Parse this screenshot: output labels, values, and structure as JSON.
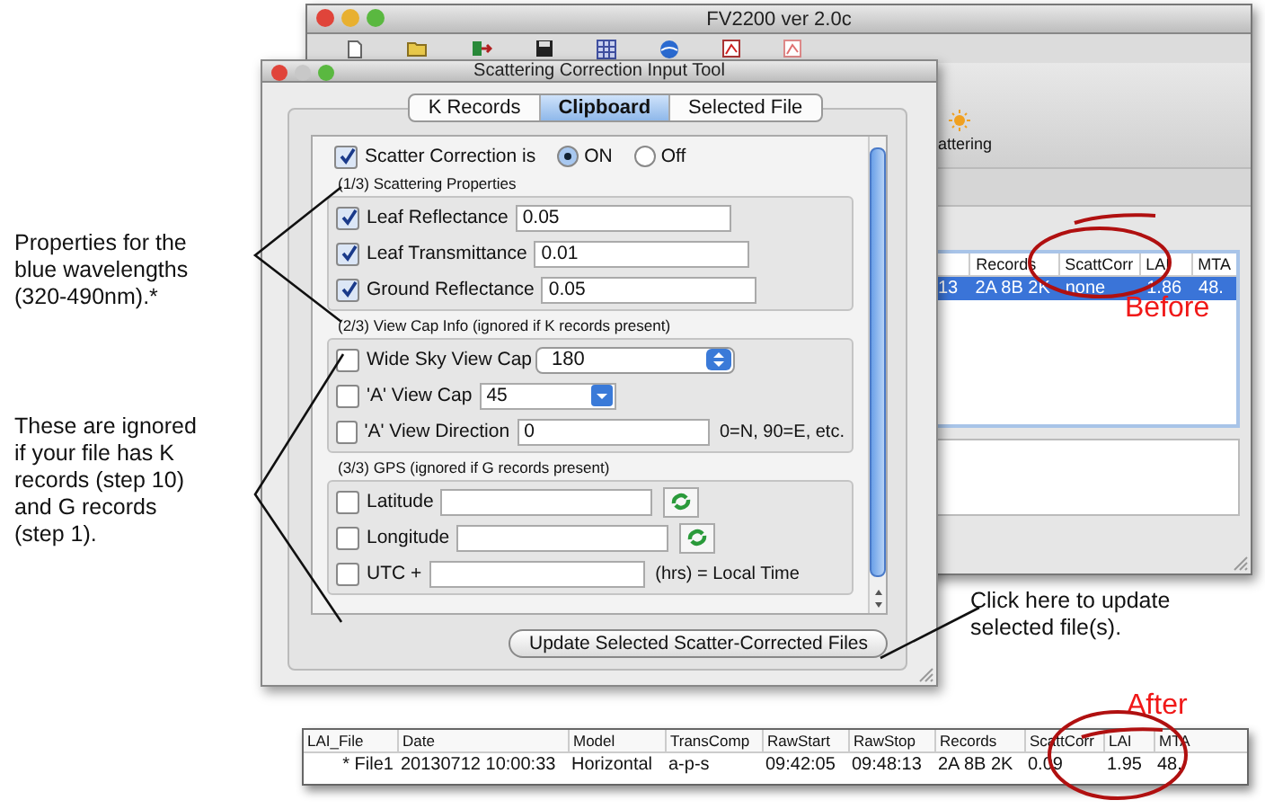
{
  "main_window": {
    "title": "FV2200 ver 2.0c",
    "ribbon_label": "attering",
    "table": {
      "columns": [
        "",
        "Records",
        "ScattCorr",
        "LAI",
        "MTA"
      ],
      "rows": [
        {
          "selected": true,
          "cells": [
            "13",
            "2A 8B 2K",
            "none",
            "1.86",
            "48."
          ]
        }
      ]
    }
  },
  "dialog": {
    "title": "Scattering Correction Input Tool",
    "tabs": [
      {
        "label": "K Records",
        "selected": false
      },
      {
        "label": "Clipboard",
        "selected": true
      },
      {
        "label": "Selected File",
        "selected": false
      }
    ],
    "scatter_correction": {
      "label": "Scatter Correction is",
      "checked": true,
      "options": [
        {
          "label": "ON",
          "selected": true
        },
        {
          "label": "Off",
          "selected": false
        }
      ]
    },
    "sections": [
      {
        "title": "(1/3) Scattering Properties",
        "rows": [
          {
            "kind": "text",
            "label": "Leaf Reflectance",
            "checked": true,
            "value": "0.05"
          },
          {
            "kind": "text",
            "label": "Leaf Transmittance",
            "checked": true,
            "value": "0.01"
          },
          {
            "kind": "text",
            "label": "Ground Reflectance",
            "checked": true,
            "value": "0.05"
          }
        ]
      },
      {
        "title": "(2/3) View Cap Info (ignored if K records present)",
        "rows": [
          {
            "kind": "popup",
            "label": "Wide Sky View Cap",
            "checked": false,
            "value": "180"
          },
          {
            "kind": "combo",
            "label": "'A' View Cap",
            "checked": false,
            "value": "45"
          },
          {
            "kind": "text",
            "label": "'A' View Direction",
            "checked": false,
            "value": "0",
            "note": "0=N, 90=E, etc."
          }
        ]
      },
      {
        "title": "(3/3) GPS (ignored if G records present)",
        "rows": [
          {
            "kind": "gps",
            "label": "Latitude",
            "checked": false
          },
          {
            "kind": "gps",
            "label": "Longitude",
            "checked": false
          },
          {
            "kind": "text",
            "label": "UTC +",
            "checked": false,
            "note": "(hrs) = Local Time"
          }
        ]
      }
    ],
    "button": "Update Selected Scatter-Corrected Files"
  },
  "result_table": {
    "columns": [
      "LAI_File",
      "Date",
      "Model",
      "TransComp",
      "RawStart",
      "RawStop",
      "Records",
      "ScattCorr",
      "LAI",
      "MTA"
    ],
    "rows": [
      {
        "selected": false,
        "cells": [
          "* File1",
          "20130712 10:00:33",
          "Horizontal",
          "a-p-s",
          "09:42:05",
          "09:48:13",
          "2A 8B 2K",
          "0.09",
          "1.95",
          "48."
        ]
      }
    ]
  },
  "annotations": [
    {
      "text": "Properties for the blue wavelengths (320-490nm).*"
    },
    {
      "text": "These are ignored if your file has K records (step 10) and G records (step 1)."
    },
    {
      "text": "Click here to update selected file(s)."
    }
  ],
  "before_label": "Before",
  "after_label": "After"
}
